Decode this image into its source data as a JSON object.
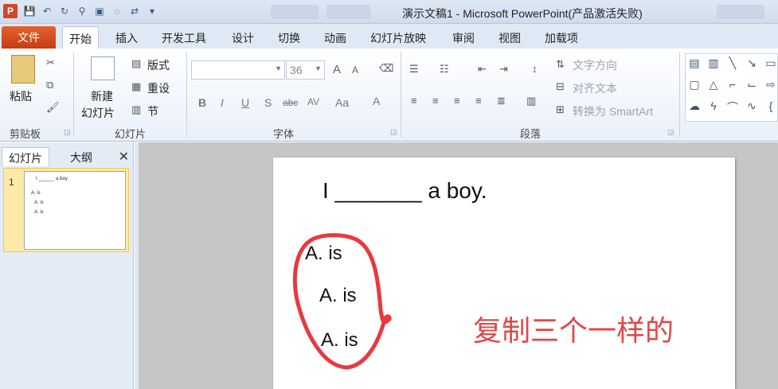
{
  "window": {
    "title": "演示文稿1 - Microsoft PowerPoint(产品激活失败)",
    "app_icon": "P"
  },
  "tabs": {
    "file": "文件",
    "items": [
      "开始",
      "插入",
      "开发工具",
      "设计",
      "切换",
      "动画",
      "幻灯片放映",
      "审阅",
      "视图",
      "加载项"
    ]
  },
  "ribbon": {
    "clipboard": {
      "paste": "粘贴",
      "group": "剪贴板"
    },
    "slides": {
      "new_line1": "新建",
      "new_line2": "幻灯片",
      "layout": "版式",
      "reset": "重设",
      "section": "节",
      "group": "幻灯片"
    },
    "font": {
      "size": "36",
      "group": "字体",
      "bold": "B",
      "italic": "I",
      "underline": "U",
      "shadow": "S",
      "strike": "abc",
      "spacing": "AV",
      "case": "Aa",
      "color": "A",
      "grow": "A",
      "shrink": "A"
    },
    "paragraph": {
      "text_direction": "文字方向",
      "align_text": "对齐文本",
      "smartart": "转换为 SmartArt",
      "group": "段落"
    }
  },
  "pane": {
    "tab_slides": "幻灯片",
    "tab_outline": "大纲",
    "close": "✕",
    "slide_number": "1",
    "thumb_title": "I ______ a boy.",
    "thumb_items": [
      "A.  is",
      "A.  is",
      "A.  is"
    ]
  },
  "slide": {
    "title": "I  _______  a boy.",
    "items": [
      "A.  is",
      "A.  is",
      "A.  is"
    ],
    "annotation": "复制三个一样的",
    "annotation_color": "#e04848"
  },
  "colors": {
    "file_tab": "#d24726",
    "ribbon_bg": "#e9f0f9",
    "selected_thumb": "#fdeaa8"
  }
}
